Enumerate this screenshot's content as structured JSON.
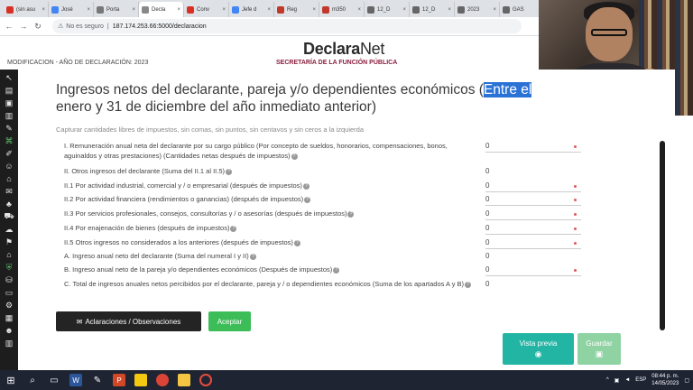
{
  "browser": {
    "tabs": [
      {
        "label": "(sin asu",
        "color": "#d93025"
      },
      {
        "label": "José",
        "color": "#4285f4"
      },
      {
        "label": "Porta",
        "color": "#777777"
      },
      {
        "label": "Decla",
        "color": "#888888"
      },
      {
        "label": "Conv",
        "color": "#d93025"
      },
      {
        "label": "Jefe d",
        "color": "#4285f4"
      },
      {
        "label": "Reg",
        "color": "#c0392b"
      },
      {
        "label": "m350",
        "color": "#c0392b"
      },
      {
        "label": "12_D",
        "color": "#666666"
      },
      {
        "label": "12_D",
        "color": "#666666"
      },
      {
        "label": "2023",
        "color": "#666666"
      },
      {
        "label": "GAS",
        "color": "#666666"
      }
    ],
    "security_label": "No es seguro",
    "url": "187.174.253.66:5000/declaracion"
  },
  "header": {
    "logo_bold": "Declara",
    "logo_light": "Net",
    "subtitle": "SECRETARÍA DE LA FUNCIÓN PÚBLICA",
    "mode_label": "MODIFICACION - AÑO DE DECLARACIÓN: 2023"
  },
  "form": {
    "title_part1": "Ingresos netos del declarante, pareja y/o dependientes económicos (",
    "title_highlight": "Entre el",
    "title_part2": " enero y 31 de diciembre del año inmediato anterior)",
    "hint": "Capturar cantidades libres de impuestos, sin comas, sin puntos, sin centavos y sin ceros a la izquierda",
    "rows": [
      {
        "label": "I. Remuneración anual neta del declarante por su cargo público (Por concepto de sueldos, honorarios, compensaciones, bonos, aguinaldos y otras prestaciones) (Cantidades netas después de impuestos)",
        "value": "0",
        "required": true,
        "input": true
      },
      {
        "label": "II. Otros ingresos del declarante (Suma del II.1 al II.5)",
        "value": "0",
        "required": false,
        "input": false
      },
      {
        "label": "II.1 Por actividad industrial, comercial y / o empresarial (después de impuestos)",
        "value": "0",
        "required": true,
        "input": true
      },
      {
        "label": "II.2 Por actividad financiera (rendimientos o ganancias) (después de impuestos)",
        "value": "0",
        "required": true,
        "input": true
      },
      {
        "label": "II.3 Por servicios profesionales, consejos, consultorías y / o asesorías (después de impuestos)",
        "value": "0",
        "required": true,
        "input": true
      },
      {
        "label": "II.4 Por enajenación de bienes (después de impuestos)",
        "value": "0",
        "required": true,
        "input": true
      },
      {
        "label": "II.5 Otros ingresos no considerados a los anteriores (después de impuestos)",
        "value": "0",
        "required": true,
        "input": true
      },
      {
        "label": "A. Ingreso anual neto del declarante (Suma del numeral I y II)",
        "value": "0",
        "required": false,
        "input": false
      },
      {
        "label": "B. Ingreso anual neto de la pareja y/o dependientes económicos (Después de impuestos)",
        "value": "0",
        "required": true,
        "input": true
      },
      {
        "label": "C. Total de ingresos anuales netos percibidos por el declarante, pareja y / o dependientes económicos (Suma de los apartados A y B)",
        "value": "0",
        "required": false,
        "input": false
      }
    ],
    "btn_aclaraciones": "Aclaraciones / Observaciones",
    "btn_aceptar": "Aceptar",
    "btn_vista_previa": "Vista previa",
    "btn_guardar": "Guardar"
  },
  "taskbar": {
    "lang": "ESP",
    "time": "08:44 p. m.",
    "date": "14/05/2023"
  }
}
